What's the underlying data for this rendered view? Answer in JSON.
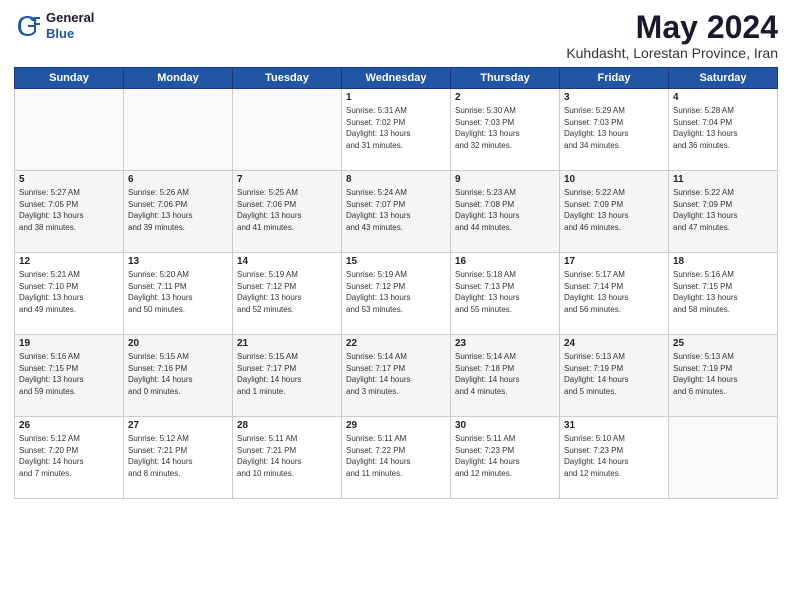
{
  "header": {
    "logo_general": "General",
    "logo_blue": "Blue",
    "month": "May 2024",
    "location": "Kuhdasht, Lorestan Province, Iran"
  },
  "weekdays": [
    "Sunday",
    "Monday",
    "Tuesday",
    "Wednesday",
    "Thursday",
    "Friday",
    "Saturday"
  ],
  "weeks": [
    [
      {
        "day": "",
        "text": ""
      },
      {
        "day": "",
        "text": ""
      },
      {
        "day": "",
        "text": ""
      },
      {
        "day": "1",
        "text": "Sunrise: 5:31 AM\nSunset: 7:02 PM\nDaylight: 13 hours\nand 31 minutes."
      },
      {
        "day": "2",
        "text": "Sunrise: 5:30 AM\nSunset: 7:03 PM\nDaylight: 13 hours\nand 32 minutes."
      },
      {
        "day": "3",
        "text": "Sunrise: 5:29 AM\nSunset: 7:03 PM\nDaylight: 13 hours\nand 34 minutes."
      },
      {
        "day": "4",
        "text": "Sunrise: 5:28 AM\nSunset: 7:04 PM\nDaylight: 13 hours\nand 36 minutes."
      }
    ],
    [
      {
        "day": "5",
        "text": "Sunrise: 5:27 AM\nSunset: 7:05 PM\nDaylight: 13 hours\nand 38 minutes."
      },
      {
        "day": "6",
        "text": "Sunrise: 5:26 AM\nSunset: 7:06 PM\nDaylight: 13 hours\nand 39 minutes."
      },
      {
        "day": "7",
        "text": "Sunrise: 5:25 AM\nSunset: 7:06 PM\nDaylight: 13 hours\nand 41 minutes."
      },
      {
        "day": "8",
        "text": "Sunrise: 5:24 AM\nSunset: 7:07 PM\nDaylight: 13 hours\nand 43 minutes."
      },
      {
        "day": "9",
        "text": "Sunrise: 5:23 AM\nSunset: 7:08 PM\nDaylight: 13 hours\nand 44 minutes."
      },
      {
        "day": "10",
        "text": "Sunrise: 5:22 AM\nSunset: 7:09 PM\nDaylight: 13 hours\nand 46 minutes."
      },
      {
        "day": "11",
        "text": "Sunrise: 5:22 AM\nSunset: 7:09 PM\nDaylight: 13 hours\nand 47 minutes."
      }
    ],
    [
      {
        "day": "12",
        "text": "Sunrise: 5:21 AM\nSunset: 7:10 PM\nDaylight: 13 hours\nand 49 minutes."
      },
      {
        "day": "13",
        "text": "Sunrise: 5:20 AM\nSunset: 7:11 PM\nDaylight: 13 hours\nand 50 minutes."
      },
      {
        "day": "14",
        "text": "Sunrise: 5:19 AM\nSunset: 7:12 PM\nDaylight: 13 hours\nand 52 minutes."
      },
      {
        "day": "15",
        "text": "Sunrise: 5:19 AM\nSunset: 7:12 PM\nDaylight: 13 hours\nand 53 minutes."
      },
      {
        "day": "16",
        "text": "Sunrise: 5:18 AM\nSunset: 7:13 PM\nDaylight: 13 hours\nand 55 minutes."
      },
      {
        "day": "17",
        "text": "Sunrise: 5:17 AM\nSunset: 7:14 PM\nDaylight: 13 hours\nand 56 minutes."
      },
      {
        "day": "18",
        "text": "Sunrise: 5:16 AM\nSunset: 7:15 PM\nDaylight: 13 hours\nand 58 minutes."
      }
    ],
    [
      {
        "day": "19",
        "text": "Sunrise: 5:16 AM\nSunset: 7:15 PM\nDaylight: 13 hours\nand 59 minutes."
      },
      {
        "day": "20",
        "text": "Sunrise: 5:15 AM\nSunset: 7:16 PM\nDaylight: 14 hours\nand 0 minutes."
      },
      {
        "day": "21",
        "text": "Sunrise: 5:15 AM\nSunset: 7:17 PM\nDaylight: 14 hours\nand 1 minute."
      },
      {
        "day": "22",
        "text": "Sunrise: 5:14 AM\nSunset: 7:17 PM\nDaylight: 14 hours\nand 3 minutes."
      },
      {
        "day": "23",
        "text": "Sunrise: 5:14 AM\nSunset: 7:18 PM\nDaylight: 14 hours\nand 4 minutes."
      },
      {
        "day": "24",
        "text": "Sunrise: 5:13 AM\nSunset: 7:19 PM\nDaylight: 14 hours\nand 5 minutes."
      },
      {
        "day": "25",
        "text": "Sunrise: 5:13 AM\nSunset: 7:19 PM\nDaylight: 14 hours\nand 6 minutes."
      }
    ],
    [
      {
        "day": "26",
        "text": "Sunrise: 5:12 AM\nSunset: 7:20 PM\nDaylight: 14 hours\nand 7 minutes."
      },
      {
        "day": "27",
        "text": "Sunrise: 5:12 AM\nSunset: 7:21 PM\nDaylight: 14 hours\nand 8 minutes."
      },
      {
        "day": "28",
        "text": "Sunrise: 5:11 AM\nSunset: 7:21 PM\nDaylight: 14 hours\nand 10 minutes."
      },
      {
        "day": "29",
        "text": "Sunrise: 5:11 AM\nSunset: 7:22 PM\nDaylight: 14 hours\nand 11 minutes."
      },
      {
        "day": "30",
        "text": "Sunrise: 5:11 AM\nSunset: 7:23 PM\nDaylight: 14 hours\nand 12 minutes."
      },
      {
        "day": "31",
        "text": "Sunrise: 5:10 AM\nSunset: 7:23 PM\nDaylight: 14 hours\nand 12 minutes."
      },
      {
        "day": "",
        "text": ""
      }
    ]
  ]
}
